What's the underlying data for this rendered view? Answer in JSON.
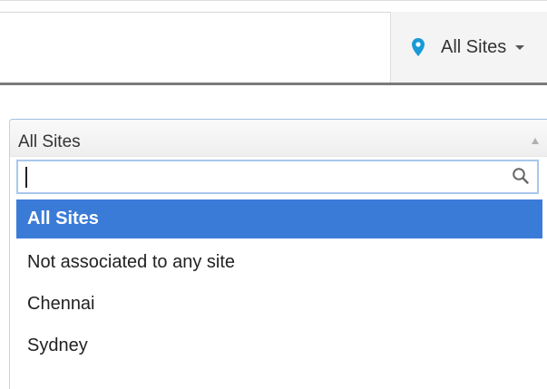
{
  "header": {
    "site_selector": {
      "label": "All Sites",
      "icon": "location-pin-icon",
      "accent_color": "#1a9ad6"
    }
  },
  "dropdown": {
    "selected_value": "All Sites",
    "search": {
      "value": "",
      "placeholder": ""
    },
    "options": [
      {
        "label": "All Sites",
        "selected": true
      },
      {
        "label": "Not associated to any site",
        "selected": false
      },
      {
        "label": "Chennai",
        "selected": false
      },
      {
        "label": "Sydney",
        "selected": false
      }
    ],
    "highlight_color": "#3b7bd8"
  }
}
